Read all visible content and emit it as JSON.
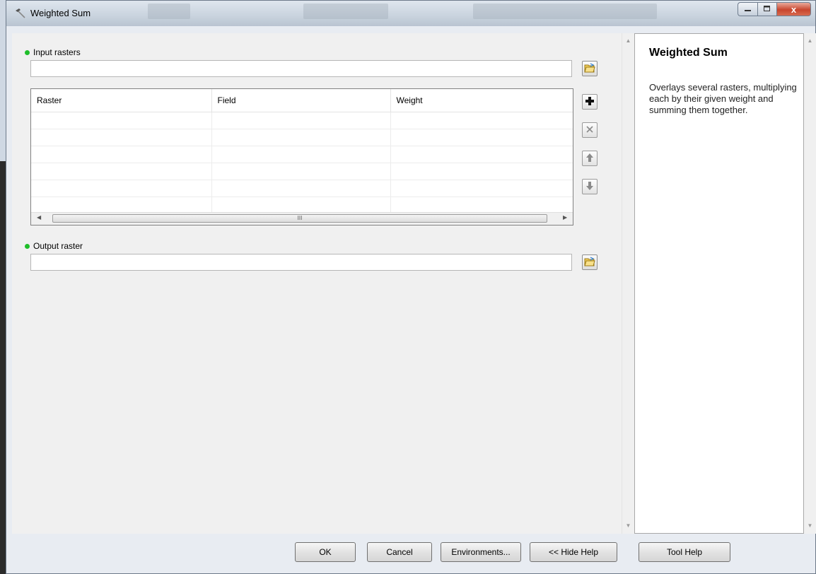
{
  "window": {
    "title": "Weighted Sum",
    "title_icon": "hammer-icon",
    "close_glyph": "x"
  },
  "params": {
    "input_rasters": {
      "label": "Input rasters",
      "value": "",
      "browse_icon": "folder-browse-icon"
    },
    "grid": {
      "columns": [
        "Raster",
        "Field",
        "Weight"
      ],
      "rows": [
        [
          "",
          "",
          ""
        ],
        [
          "",
          "",
          ""
        ],
        [
          "",
          "",
          ""
        ],
        [
          "",
          "",
          ""
        ],
        [
          "",
          "",
          ""
        ],
        [
          "",
          "",
          ""
        ],
        [
          "",
          "",
          ""
        ]
      ],
      "scroll_thumb_glyph": "III",
      "side_buttons": [
        {
          "name": "add-row-button",
          "icon": "plus-icon"
        },
        {
          "name": "remove-row-button",
          "icon": "delete-x-icon"
        },
        {
          "name": "move-up-button",
          "icon": "arrow-up-icon"
        },
        {
          "name": "move-down-button",
          "icon": "arrow-down-icon"
        }
      ]
    },
    "output_raster": {
      "label": "Output raster",
      "value": "",
      "browse_icon": "folder-browse-icon"
    }
  },
  "help": {
    "title": "Weighted Sum",
    "text": "Overlays several rasters, multiplying each by their given weight and summing them together."
  },
  "buttons": {
    "ok": "OK",
    "cancel": "Cancel",
    "environments": "Environments...",
    "hide_help": "<< Hide Help",
    "tool_help": "Tool Help"
  },
  "colors": {
    "required_dot": "#1fbe2a",
    "close_button": "#c8452d"
  }
}
